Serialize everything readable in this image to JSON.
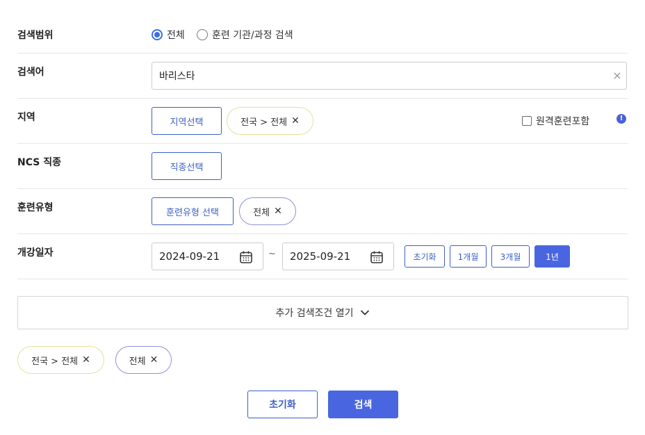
{
  "scope": {
    "label": "검색범위",
    "options": [
      {
        "label": "전체",
        "selected": true
      },
      {
        "label": "훈련 기관/과정 검색",
        "selected": false
      }
    ]
  },
  "keyword": {
    "label": "검색어",
    "value": "바리스타",
    "clear_icon": "close-icon"
  },
  "region": {
    "label": "지역",
    "select_button": "지역선택",
    "chip": "전국 > 전체",
    "remote_checkbox": "원격훈련포함",
    "remote_checked": false,
    "info_icon": "info-icon"
  },
  "ncs": {
    "label": "NCS 직종",
    "select_button": "직종선택"
  },
  "training_type": {
    "label": "훈련유형",
    "select_button": "훈련유형 선택",
    "chip": "전체"
  },
  "start_date": {
    "label": "개강일자",
    "from": "2024-09-21",
    "to": "2025-09-21",
    "separator": "~",
    "quick_buttons": [
      {
        "label": "초기화",
        "active": false
      },
      {
        "label": "1개월",
        "active": false
      },
      {
        "label": "3개월",
        "active": false
      },
      {
        "label": "1년",
        "active": true
      }
    ]
  },
  "more_conditions": {
    "label": "추가 검색조건 열기",
    "icon": "chevron-down-icon"
  },
  "selected_filters": [
    {
      "label": "전국 > 전체"
    },
    {
      "label": "전체"
    }
  ],
  "actions": {
    "reset": "초기화",
    "search": "검색"
  },
  "colors": {
    "accent": "#4966e0",
    "outline": "#3d5fc4",
    "chip_yellow": "#e4e29a",
    "chip_blue": "#8d90d6"
  }
}
